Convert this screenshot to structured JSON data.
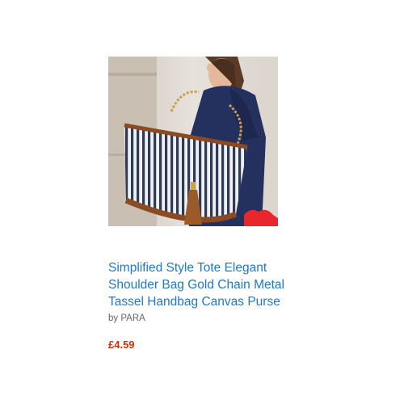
{
  "product": {
    "title": "Simplified Style Tote Elegant Shoulder Bag Gold Chain Metal Tassel Handbag Canvas Purse",
    "seller_prefix": "by",
    "seller": "PARA",
    "price": "£4.59",
    "image_alt": "Simplified Style Tote Elegant Shoulder Bag Gold Chain Metal Tassel Handbag Canvas Purse"
  },
  "colors": {
    "link": "#1f78c8",
    "price": "#cc3300",
    "seller_text": "#666666",
    "badge": "#e8262b"
  }
}
